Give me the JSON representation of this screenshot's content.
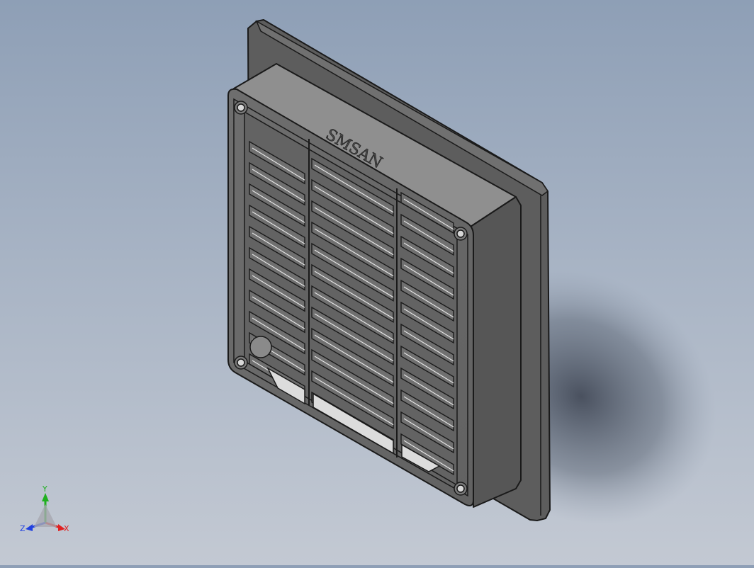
{
  "viewport": {
    "background_top": "#8e9fb6",
    "background_bottom": "#c3c9d3"
  },
  "model": {
    "engraved_text": "SMSAN",
    "body_color": "#5f5f5f",
    "face_color": "#6b6b6b",
    "edge_color": "#1a1a1a",
    "opening_color": "#dcdcdc"
  },
  "triad": {
    "x_label": "X",
    "y_label": "Y",
    "z_label": "Z",
    "x_color": "#e02020",
    "y_color": "#20b020",
    "z_color": "#2040e0"
  }
}
